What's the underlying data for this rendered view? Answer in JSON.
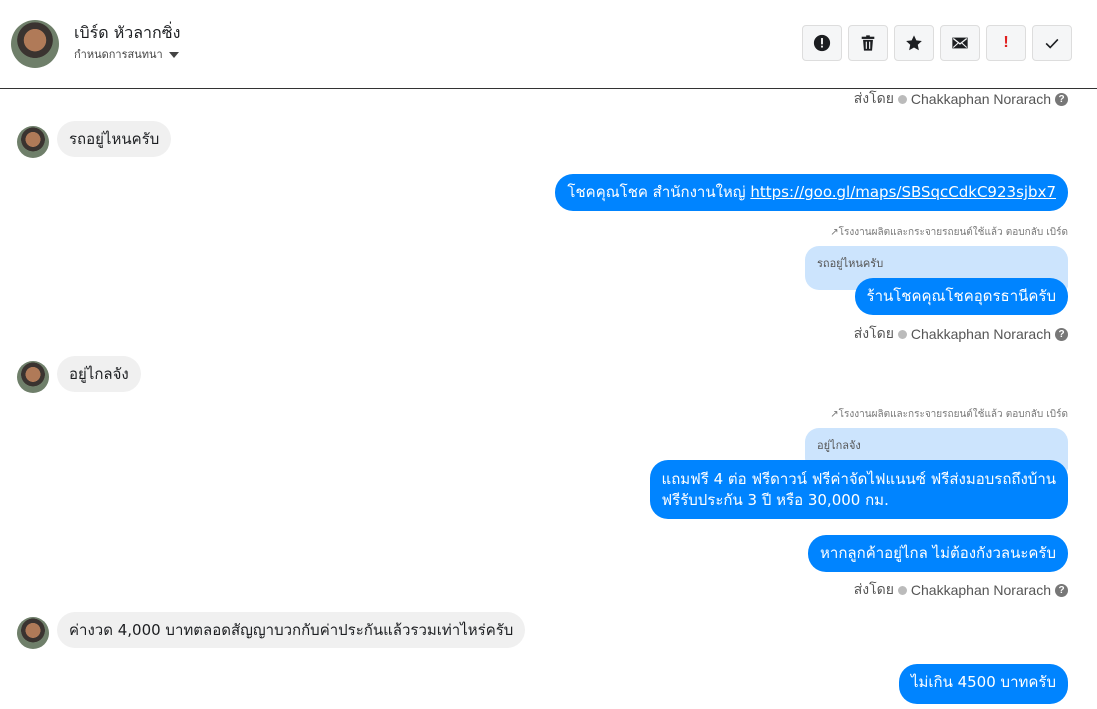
{
  "header": {
    "name": "เบิร์ด หัวลากซิ่ง",
    "subtitle": "กำหนดการสนทนา",
    "actions": [
      {
        "icon": "alert-circle-icon"
      },
      {
        "icon": "trash-icon"
      },
      {
        "icon": "star-icon"
      },
      {
        "icon": "envelope-icon"
      },
      {
        "icon": "exclamation-icon",
        "label": "!"
      },
      {
        "icon": "check-icon"
      }
    ]
  },
  "conversation": {
    "sent_by_prefix": "ส่งโดย",
    "sender_name": "Chakkaphan Norarach",
    "messages": {
      "in1": "รถอยู่ไหนครับ",
      "out1_text": "โชคคุณโชค สำนักงานใหญ่ ",
      "out1_link": "https://goo.gl/maps/SBSqcCdkC923sjbx7",
      "reply1_note": "โรงงานผลิตและกระจายรถยนต์ใช้แล้ว ตอบกลับ เบิร์ด",
      "quote1": "รถอยู่ไหนครับ",
      "out2": "ร้านโชคคุณโชคอุดรธานีครับ",
      "in2": "อยู่ไกลจัง",
      "reply2_note": "โรงงานผลิตและกระจายรถยนต์ใช้แล้ว ตอบกลับ เบิร์ด",
      "quote2": "อยู่ไกลจัง",
      "out3_line1": "แถมฟรี 4 ต่อ ฟรีดาวน์ ฟรีค่าจัดไฟแนนซ์ ฟรีส่งมอบรถถึงบ้าน",
      "out3_line2": "ฟรีรับประกัน 3 ปี หรือ 30,000 กม.",
      "out4": "หากลูกค้าอยู่ไกล ไม่ต้องกังวลนะครับ",
      "in3": "ค่างวด 4,000 บาทตลอดสัญญาบวกกับค่าประกันแล้วรวมเท่าไหร่ครับ",
      "out5": "ไม่เกิน 4500 บาทครับ"
    }
  },
  "colors": {
    "outgoing": "#0084ff",
    "incoming": "#f0f0f0",
    "quote": "#cce4fd"
  }
}
